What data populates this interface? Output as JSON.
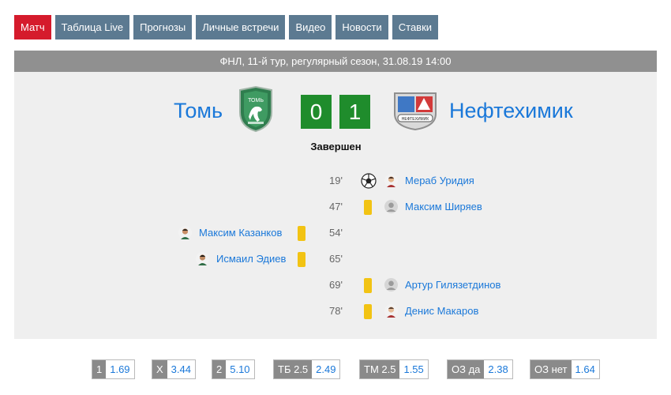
{
  "tabs": [
    {
      "label": "Матч",
      "active": true
    },
    {
      "label": "Таблица Live"
    },
    {
      "label": "Прогнозы"
    },
    {
      "label": "Личные встречи"
    },
    {
      "label": "Видео"
    },
    {
      "label": "Новости"
    },
    {
      "label": "Ставки"
    }
  ],
  "match": {
    "header": "ФНЛ, 11-й тур, регулярный сезон, 31.08.19 14:00",
    "home_team": "Томь",
    "away_team": "Нефтехимик",
    "home_score": "0",
    "away_score": "1",
    "status": "Завершен",
    "home_logo_text": "ТОМЬ",
    "away_logo_text": "НЕФТЕХИМИК"
  },
  "events": [
    {
      "minute": "19'",
      "side": "away",
      "type": "goal",
      "player": "Мераб Уридия"
    },
    {
      "minute": "47'",
      "side": "away",
      "type": "yellow-card",
      "player": "Максим Ширяев"
    },
    {
      "minute": "54'",
      "side": "home",
      "type": "yellow-card",
      "player": "Максим Казанков"
    },
    {
      "minute": "65'",
      "side": "home",
      "type": "yellow-card",
      "player": "Исмаил Эдиев"
    },
    {
      "minute": "69'",
      "side": "away",
      "type": "yellow-card",
      "player": "Артур Гилязетдинов"
    },
    {
      "minute": "78'",
      "side": "away",
      "type": "yellow-card",
      "player": "Денис Макаров"
    }
  ],
  "odds": [
    {
      "label": "1",
      "value": "1.69"
    },
    {
      "label": "X",
      "value": "3.44"
    },
    {
      "label": "2",
      "value": "5.10"
    },
    {
      "label": "ТБ 2.5",
      "value": "2.49"
    },
    {
      "label": "ТМ 2.5",
      "value": "1.55"
    },
    {
      "label": "ОЗ да",
      "value": "2.38"
    },
    {
      "label": "ОЗ нет",
      "value": "1.64"
    }
  ],
  "colors": {
    "tab": "#5c7a91",
    "tab_active": "#d51b2c",
    "score_bg": "#1f8c2c",
    "link": "#1a78d9",
    "yellow_card": "#f2c313"
  }
}
